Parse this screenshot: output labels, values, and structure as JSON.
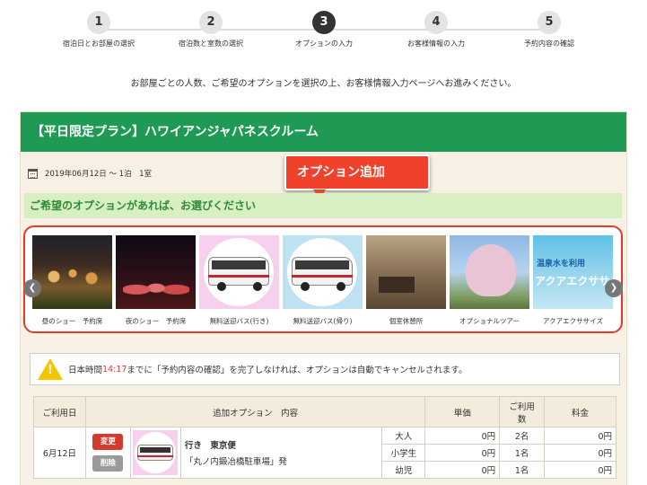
{
  "steps": [
    {
      "num": "1",
      "label": "宿泊日とお部屋の選択"
    },
    {
      "num": "2",
      "label": "宿泊数と室数の選択"
    },
    {
      "num": "3",
      "label": "オプションの入力"
    },
    {
      "num": "4",
      "label": "お客様情報の入力"
    },
    {
      "num": "5",
      "label": "予約内容の確認"
    }
  ],
  "intro": "お部屋ごとの人数、ご希望のオプションを選択の上、お客様情報入力ページへお進みください。",
  "plan": {
    "title": "【平日限定プラン】ハワイアンジャパネスクルーム",
    "date": "2019年06月12日 ～ 1泊　1室"
  },
  "callout": "オプション追加",
  "options_banner": "ご希望のオプションがあれば、お選びください",
  "options": [
    {
      "label": "昼のショー　予約席"
    },
    {
      "label": "夜のショー　予約席"
    },
    {
      "label": "無料送迎バス(行き)"
    },
    {
      "label": "無料送迎バス(帰り)"
    },
    {
      "label": "個室休憩所"
    },
    {
      "label": "オプショナルツアー"
    },
    {
      "label": "アクアエクササイズ"
    }
  ],
  "aqua_thumb": {
    "line1": "温泉水を利用",
    "line2": "アクアエクササイズ"
  },
  "notice": {
    "before": "日本時間",
    "time": "14:17",
    "after": "までに「予約内容の確認」を完了しなければ、オプションは自動でキャンセルされます。"
  },
  "table": {
    "headers": {
      "date": "ご利用日",
      "content": "追加オプション　内容",
      "unit_price": "単価",
      "count_line1": "ご利用",
      "count_line2": "数",
      "fee": "料金"
    },
    "row": {
      "date": "6月12日",
      "change_btn": "変更",
      "delete_btn": "削除",
      "title": "行き　東京便",
      "subtitle": "「丸ノ内鍛冶橋駐車場」発",
      "lines": [
        {
          "type": "大人",
          "price": "0円",
          "count": "2名",
          "fee": "0円"
        },
        {
          "type": "小学生",
          "price": "0円",
          "count": "1名",
          "fee": "0円"
        },
        {
          "type": "幼児",
          "price": "0円",
          "count": "1名",
          "fee": "0円"
        }
      ]
    }
  }
}
